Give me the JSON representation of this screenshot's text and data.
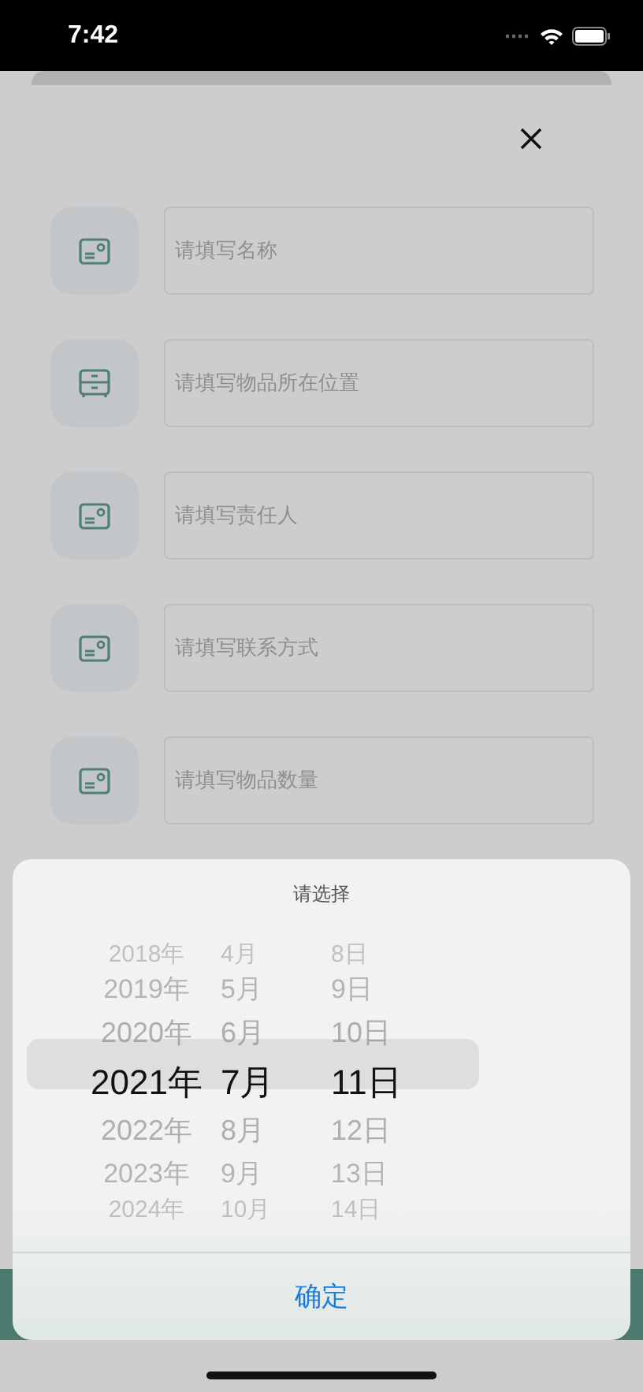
{
  "status_bar": {
    "time": "7:42"
  },
  "fields": [
    {
      "kind": "card",
      "placeholder": "请填写名称"
    },
    {
      "kind": "drawer",
      "placeholder": "请填写物品所在位置"
    },
    {
      "kind": "card",
      "placeholder": "请填写责任人"
    },
    {
      "kind": "card",
      "placeholder": "请填写联系方式"
    },
    {
      "kind": "card",
      "placeholder": "请填写物品数量"
    }
  ],
  "picker": {
    "title": "请选择",
    "columns": [
      {
        "items": [
          {
            "label": "2018年",
            "selected": false
          },
          {
            "label": "2019年",
            "selected": false
          },
          {
            "label": "2020年",
            "selected": false
          },
          {
            "label": "2021年",
            "selected": true
          },
          {
            "label": "2022年",
            "selected": false
          },
          {
            "label": "2023年",
            "selected": false
          },
          {
            "label": "2024年",
            "selected": false
          }
        ]
      },
      {
        "items": [
          {
            "label": "4月",
            "selected": false
          },
          {
            "label": "5月",
            "selected": false
          },
          {
            "label": "6月",
            "selected": false
          },
          {
            "label": "7月",
            "selected": true
          },
          {
            "label": "8月",
            "selected": false
          },
          {
            "label": "9月",
            "selected": false
          },
          {
            "label": "10月",
            "selected": false
          }
        ]
      },
      {
        "items": [
          {
            "label": "8日",
            "selected": false
          },
          {
            "label": "9日",
            "selected": false
          },
          {
            "label": "10日",
            "selected": false
          },
          {
            "label": "11日",
            "selected": true
          },
          {
            "label": "12日",
            "selected": false
          },
          {
            "label": "13日",
            "selected": false
          },
          {
            "label": "14日",
            "selected": false
          }
        ]
      }
    ],
    "confirm": "确定"
  }
}
